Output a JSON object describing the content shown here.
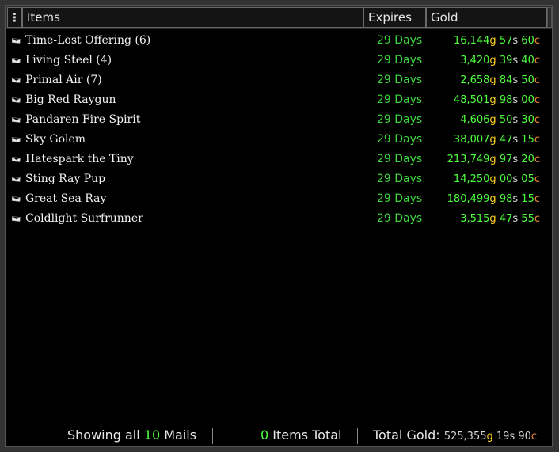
{
  "header": {
    "menu_glyph": "⋮",
    "col_items": "Items",
    "col_expires": "Expires",
    "col_gold": "Gold"
  },
  "colors": {
    "item_name": "#f2f2f2",
    "expires": "#3fd63f",
    "gold_number": "#4dff3d",
    "gold_unit": "#ffd21e",
    "silver_unit": "#d6d6d6",
    "copper_unit": "#ee8a3a"
  },
  "units": {
    "gold": "g",
    "silver": "s",
    "copper": "c"
  },
  "rows": [
    {
      "name": "Time-Lost Offering (6)",
      "expires": "29 Days",
      "g": "16,144",
      "s": "57",
      "c": "60"
    },
    {
      "name": "Living Steel (4)",
      "expires": "29 Days",
      "g": "3,420",
      "s": "39",
      "c": "40"
    },
    {
      "name": "Primal Air (7)",
      "expires": "29 Days",
      "g": "2,658",
      "s": "84",
      "c": "50"
    },
    {
      "name": "Big Red Raygun",
      "expires": "29 Days",
      "g": "48,501",
      "s": "98",
      "c": "00"
    },
    {
      "name": "Pandaren Fire Spirit",
      "expires": "29 Days",
      "g": "4,606",
      "s": "50",
      "c": "30"
    },
    {
      "name": "Sky Golem",
      "expires": "29 Days",
      "g": "38,007",
      "s": "47",
      "c": "15"
    },
    {
      "name": "Hatespark the Tiny",
      "expires": "29 Days",
      "g": "213,749",
      "s": "97",
      "c": "20"
    },
    {
      "name": "Sting Ray Pup",
      "expires": "29 Days",
      "g": "14,250",
      "s": "00",
      "c": "05"
    },
    {
      "name": "Great Sea Ray",
      "expires": "29 Days",
      "g": "180,499",
      "s": "98",
      "c": "15"
    },
    {
      "name": "Coldlight Surfrunner",
      "expires": "29 Days",
      "g": "3,515",
      "s": "47",
      "c": "55"
    }
  ],
  "footer": {
    "showing_prefix": "Showing all",
    "mail_count": "10",
    "showing_suffix": "Mails",
    "items_count": "0",
    "items_label": "Items Total",
    "total_label": "Total Gold:",
    "total_g": "525,355",
    "total_s": "19",
    "total_c": "90"
  }
}
